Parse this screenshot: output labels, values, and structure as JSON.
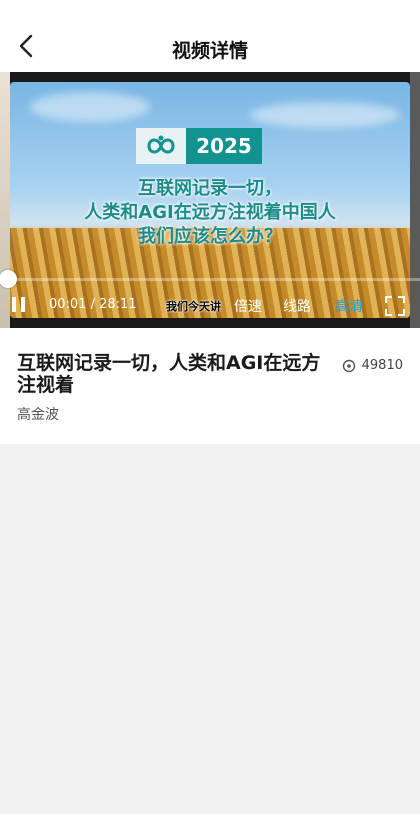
{
  "header": {
    "title": "视频详情"
  },
  "video": {
    "slide_year": "2025",
    "slide_lines": [
      "互联网记录一切，",
      "人类和AGI在远方注视着中国人",
      "我们应该怎么办？"
    ],
    "subtitle": "我们今天讲",
    "current_time": "00:01",
    "duration": "28:11",
    "progress": 0.0006,
    "speed_label": "倍速",
    "route_label": "线路",
    "quality_label": "高清"
  },
  "info": {
    "title": "互联网记录一切，人类和AGI在远方注视着",
    "views": "49810",
    "author": "高金波"
  },
  "colors": {
    "accent": "#19a3e0",
    "slide_teal": "#13938f"
  },
  "icons": {
    "back": "chevron-left-icon",
    "pause": "pause-icon",
    "fullscreen": "fullscreen-icon",
    "views": "play-circle-icon"
  }
}
